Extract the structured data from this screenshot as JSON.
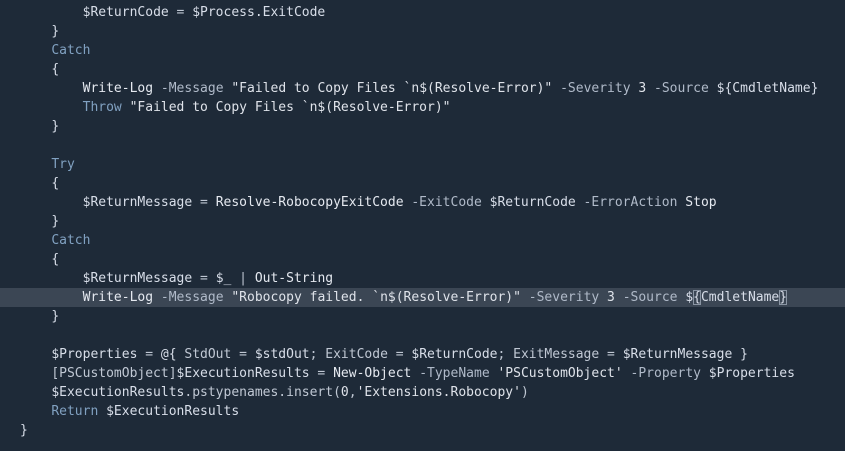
{
  "editor": {
    "language": "powershell",
    "current_line_index": 15,
    "lines": [
      {
        "indent": "        ",
        "tokens": [
          {
            "t": "$ReturnCode",
            "c": "var"
          },
          {
            "t": " = ",
            "c": "op"
          },
          {
            "t": "$Process.ExitCode",
            "c": "var"
          }
        ]
      },
      {
        "indent": "    ",
        "tokens": [
          {
            "t": "}",
            "c": "punct"
          }
        ]
      },
      {
        "indent": "    ",
        "tokens": [
          {
            "t": "Catch",
            "c": "kw"
          }
        ]
      },
      {
        "indent": "    ",
        "tokens": [
          {
            "t": "{",
            "c": "punct"
          }
        ]
      },
      {
        "indent": "        ",
        "tokens": [
          {
            "t": "Write-Log",
            "c": "cmd"
          },
          {
            "t": " -Message ",
            "c": "param"
          },
          {
            "t": "\"Failed to Copy Files `n$(Resolve-Error)\"",
            "c": "str"
          },
          {
            "t": " -Severity ",
            "c": "param"
          },
          {
            "t": "3",
            "c": "num"
          },
          {
            "t": " -Source ",
            "c": "param"
          },
          {
            "t": "${",
            "c": "punct"
          },
          {
            "t": "CmdletName",
            "c": "var"
          },
          {
            "t": "}",
            "c": "punct"
          }
        ]
      },
      {
        "indent": "        ",
        "tokens": [
          {
            "t": "Throw",
            "c": "kw"
          },
          {
            "t": " ",
            "c": "op"
          },
          {
            "t": "\"Failed to Copy Files `n$(Resolve-Error)\"",
            "c": "str"
          }
        ]
      },
      {
        "indent": "    ",
        "tokens": [
          {
            "t": "}",
            "c": "punct"
          }
        ]
      },
      {
        "indent": "",
        "tokens": []
      },
      {
        "indent": "    ",
        "tokens": [
          {
            "t": "Try",
            "c": "kw"
          }
        ]
      },
      {
        "indent": "    ",
        "tokens": [
          {
            "t": "{",
            "c": "punct"
          }
        ]
      },
      {
        "indent": "        ",
        "tokens": [
          {
            "t": "$ReturnMessage",
            "c": "var"
          },
          {
            "t": " = ",
            "c": "op"
          },
          {
            "t": "Resolve-RobocopyExitCode",
            "c": "cmd"
          },
          {
            "t": " -ExitCode ",
            "c": "param"
          },
          {
            "t": "$ReturnCode",
            "c": "var"
          },
          {
            "t": " -ErrorAction ",
            "c": "param"
          },
          {
            "t": "Stop",
            "c": "cmd"
          }
        ]
      },
      {
        "indent": "    ",
        "tokens": [
          {
            "t": "}",
            "c": "punct"
          }
        ]
      },
      {
        "indent": "    ",
        "tokens": [
          {
            "t": "Catch",
            "c": "kw"
          }
        ]
      },
      {
        "indent": "    ",
        "tokens": [
          {
            "t": "{",
            "c": "punct"
          }
        ]
      },
      {
        "indent": "        ",
        "tokens": [
          {
            "t": "$ReturnMessage",
            "c": "var"
          },
          {
            "t": " = ",
            "c": "op"
          },
          {
            "t": "$_",
            "c": "var"
          },
          {
            "t": " | ",
            "c": "op"
          },
          {
            "t": "Out-String",
            "c": "cmd"
          }
        ]
      },
      {
        "indent": "        ",
        "tokens": [
          {
            "t": "Write-Log",
            "c": "cmd"
          },
          {
            "t": " -Message ",
            "c": "param"
          },
          {
            "t": "\"Robocopy failed. `n$(Resolve-Error)\"",
            "c": "str"
          },
          {
            "t": " -Severity ",
            "c": "param"
          },
          {
            "t": "3",
            "c": "num"
          },
          {
            "t": " -Source ",
            "c": "param"
          },
          {
            "t": "$",
            "c": "punct"
          },
          {
            "t": "{",
            "c": "punct",
            "match": true
          },
          {
            "t": "CmdletName",
            "c": "var"
          },
          {
            "t": "}",
            "c": "punct",
            "match": true
          }
        ]
      },
      {
        "indent": "    ",
        "tokens": [
          {
            "t": "}",
            "c": "punct"
          }
        ]
      },
      {
        "indent": "",
        "tokens": []
      },
      {
        "indent": "    ",
        "tokens": [
          {
            "t": "$Properties",
            "c": "var"
          },
          {
            "t": " = ",
            "c": "op"
          },
          {
            "t": "@{",
            "c": "punct"
          },
          {
            "t": " StdOut = ",
            "c": "op"
          },
          {
            "t": "$stdOut",
            "c": "var"
          },
          {
            "t": "; ExitCode = ",
            "c": "op"
          },
          {
            "t": "$ReturnCode",
            "c": "var"
          },
          {
            "t": "; ExitMessage = ",
            "c": "op"
          },
          {
            "t": "$ReturnMessage",
            "c": "var"
          },
          {
            "t": " }",
            "c": "punct"
          }
        ]
      },
      {
        "indent": "    ",
        "tokens": [
          {
            "t": "[PSCustomObject]",
            "c": "op"
          },
          {
            "t": "$ExecutionResults",
            "c": "var"
          },
          {
            "t": " = ",
            "c": "op"
          },
          {
            "t": "New-Object",
            "c": "cmd"
          },
          {
            "t": " -TypeName ",
            "c": "param"
          },
          {
            "t": "'PSCustomObject'",
            "c": "str"
          },
          {
            "t": " -Property ",
            "c": "param"
          },
          {
            "t": "$Properties",
            "c": "var"
          }
        ]
      },
      {
        "indent": "    ",
        "tokens": [
          {
            "t": "$ExecutionResults",
            "c": "var"
          },
          {
            "t": ".pstypenames.insert(",
            "c": "op"
          },
          {
            "t": "0",
            "c": "num"
          },
          {
            "t": ",",
            "c": "op"
          },
          {
            "t": "'Extensions.Robocopy'",
            "c": "str"
          },
          {
            "t": ")",
            "c": "op"
          }
        ]
      },
      {
        "indent": "    ",
        "tokens": [
          {
            "t": "Return",
            "c": "kw"
          },
          {
            "t": " ",
            "c": "op"
          },
          {
            "t": "$ExecutionResults",
            "c": "var"
          }
        ]
      },
      {
        "indent": "",
        "tokens": [
          {
            "t": "}",
            "c": "punct"
          }
        ]
      }
    ]
  }
}
